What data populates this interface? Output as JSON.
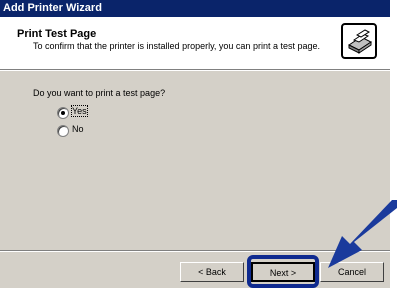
{
  "window": {
    "title": "Add Printer Wizard"
  },
  "header": {
    "title": "Print Test Page",
    "subtitle": "To confirm that the printer is installed properly, you can print a test page.",
    "icon": "printer-icon"
  },
  "body": {
    "question": "Do you want to print a test page?",
    "options": [
      {
        "label": "Yes",
        "selected": true
      },
      {
        "label": "No",
        "selected": false
      }
    ]
  },
  "buttons": {
    "back": "< Back",
    "next": "Next >",
    "cancel": "Cancel"
  },
  "colors": {
    "titlebar": "#0a246a",
    "dialog": "#d4d0c8",
    "highlight": "#0f2a8f",
    "arrow": "#1a3a9c"
  }
}
